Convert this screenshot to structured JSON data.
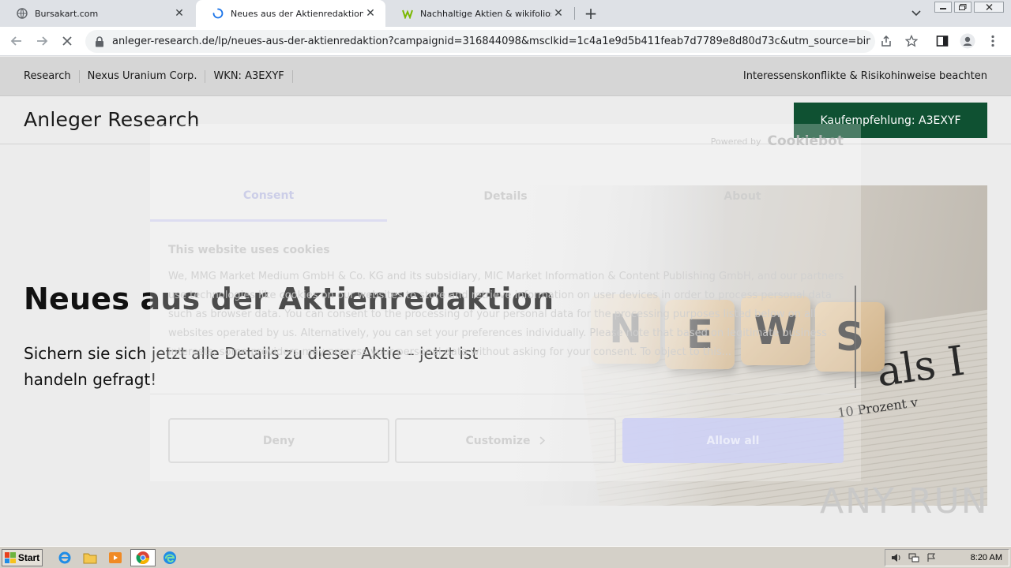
{
  "browser": {
    "tabs": [
      {
        "title": "Bursakart.com",
        "favicon": "globe-icon",
        "active": false
      },
      {
        "title": "Neues aus der Aktienredaktion",
        "favicon": "loading-spinner-icon",
        "active": true
      },
      {
        "title": "Nachhaltige Aktien & wikifolios | wikif",
        "favicon": "wikifolio-icon",
        "active": false
      }
    ],
    "new_tab_symbol": "+",
    "close_symbol": "✕",
    "url": "anleger-research.de/lp/neues-aus-der-aktienredaktion?campaignid=316844098&msclkid=1c4a1e9d5b411feab7d7789e8d80d73c&utm_source=bing&utm..."
  },
  "topnav": {
    "items": [
      "Research",
      "Nexus Uranium Corp.",
      "WKN: A3EXYF"
    ],
    "disclaimer": "Interessenskonflikte & Risikohinweise beachten"
  },
  "header": {
    "brand": "Anleger Research",
    "cta": "Kaufempfehlung: A3EXYF",
    "cta_color": "#0f5132"
  },
  "hero": {
    "headline": "Neues aus der Aktienredaktion",
    "subline": "Sichern sie sich jetzt alle Details zu dieser Aktie – jetzt ist handeln gefragt!",
    "cubes": [
      "N",
      "E",
      "W",
      "S"
    ],
    "paper_headline": "als I",
    "paper_subline": "10 Prozent v"
  },
  "consent": {
    "powered_by": "Powered by",
    "logo": "Cookiebot",
    "tabs": [
      "Consent",
      "Details",
      "About"
    ],
    "title": "This website uses cookies",
    "body": "We, MMG Market Medium GmbH & Co. KG and its subsidiary, MIC Market Information & Content Publishing GmbH, and our partners use technologies like cookies on our websites to store and retrieve information on user devices in order to process personal data such as browser data. You can consent to the processing of your personal data for the processing purposes listed below on all websites operated by us. Alternatively, you can set your preferences individually. Please note that based on legitimate business interests, some providers may process your personal data without asking for your consent. To object to this...",
    "buttons": {
      "deny": "Deny",
      "customize": "Customize",
      "allow": "Allow all"
    }
  },
  "watermark": "ANY RUN",
  "taskbar": {
    "start": "Start",
    "clock": "8:20 AM"
  }
}
